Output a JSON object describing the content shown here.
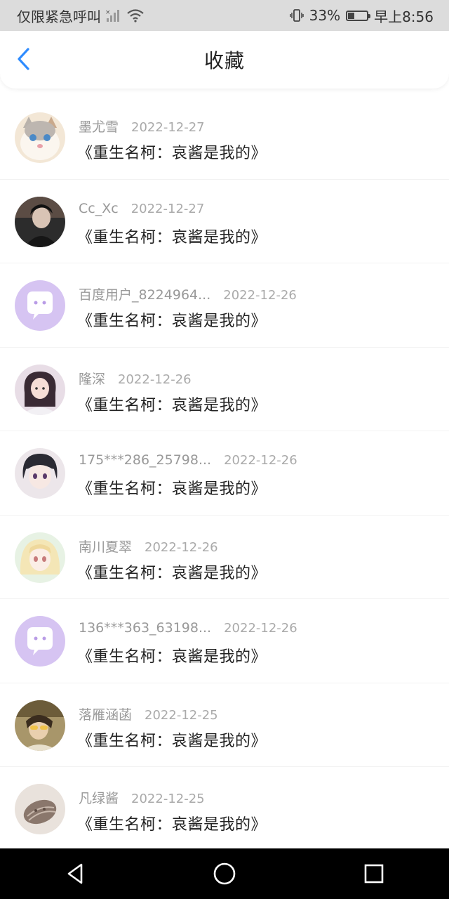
{
  "status_bar": {
    "carrier": "仅限紧急呼叫",
    "battery_percent": "33%",
    "time": "早上8:56",
    "battery_level": 0.33
  },
  "header": {
    "title": "收藏",
    "back_icon": "chevron-left-icon",
    "accent_color": "#2f8cff"
  },
  "favorites": [
    {
      "user": "墨尤雪",
      "date": "2022-12-27",
      "title": "《重生名柯：哀酱是我的》",
      "avatar": "cat"
    },
    {
      "user": "Cc_Xc",
      "date": "2022-12-27",
      "title": "《重生名柯：哀酱是我的》",
      "avatar": "dark"
    },
    {
      "user": "百度用户_8224964...",
      "date": "2022-12-26",
      "title": "《重生名柯：哀酱是我的》",
      "avatar": "default"
    },
    {
      "user": "隆深",
      "date": "2022-12-26",
      "title": "《重生名柯：哀酱是我的》",
      "avatar": "girl"
    },
    {
      "user": "175***286_25798...",
      "date": "2022-12-26",
      "title": "《重生名柯：哀酱是我的》",
      "avatar": "anime-dark"
    },
    {
      "user": "南川夏翠",
      "date": "2022-12-26",
      "title": "《重生名柯：哀酱是我的》",
      "avatar": "anime-light"
    },
    {
      "user": "136***363_63198...",
      "date": "2022-12-26",
      "title": "《重生名柯：哀酱是我的》",
      "avatar": "default"
    },
    {
      "user": "落雁涵菡",
      "date": "2022-12-25",
      "title": "《重生名柯：哀酱是我的》",
      "avatar": "yellow"
    },
    {
      "user": "凡绿酱",
      "date": "2022-12-25",
      "title": "《重生名柯：哀酱是我的》",
      "avatar": "shell"
    }
  ],
  "bottom_nav": {
    "back": "back-triangle-icon",
    "home": "home-circle-icon",
    "recents": "recents-square-icon"
  }
}
